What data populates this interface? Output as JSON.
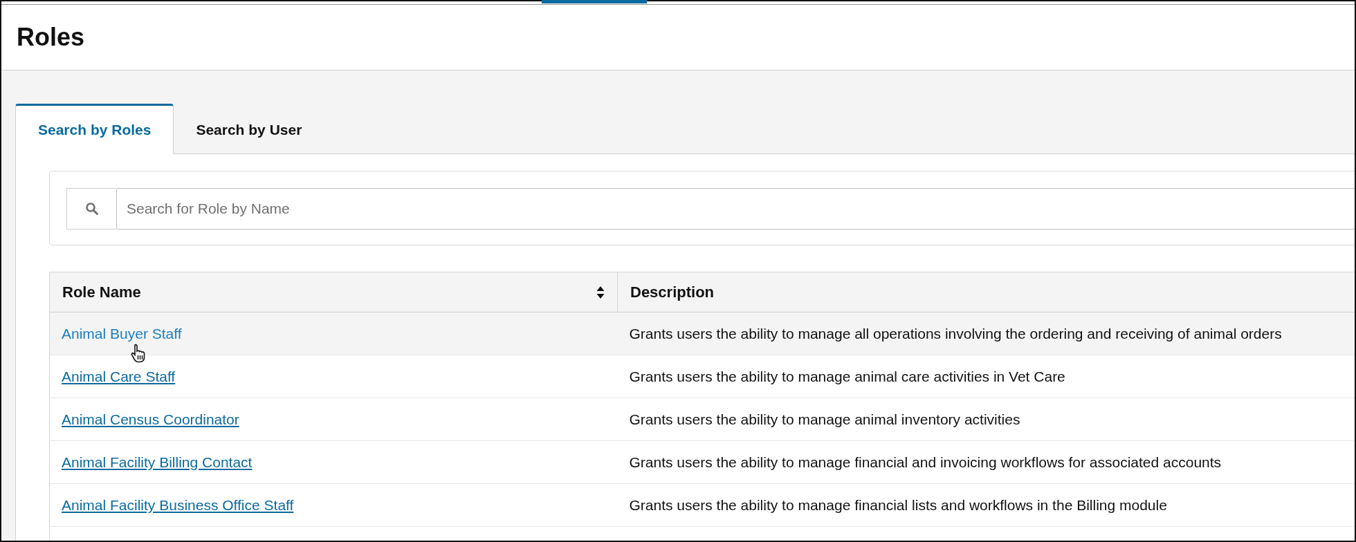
{
  "page": {
    "title": "Roles"
  },
  "tabs": [
    {
      "label": "Search by Roles",
      "selected": true
    },
    {
      "label": "Search by User",
      "selected": false
    }
  ],
  "search": {
    "placeholder": "Search for Role by Name"
  },
  "table": {
    "columns": [
      {
        "label": "Role Name",
        "sortable": true
      },
      {
        "label": "Description",
        "sortable": false
      }
    ],
    "rows": [
      {
        "role_name": "Animal Buyer Staff",
        "description": "Grants users the ability to manage all operations involving the ordering and receiving of animal orders",
        "hovered": true
      },
      {
        "role_name": "Animal Care Staff",
        "description": "Grants users the ability to manage animal care activities in Vet Care",
        "hovered": false
      },
      {
        "role_name": "Animal Census Coordinator",
        "description": "Grants users the ability to manage animal inventory activities",
        "hovered": false
      },
      {
        "role_name": "Animal Facility Billing Contact",
        "description": "Grants users the ability to manage financial and invoicing workflows for associated accounts",
        "hovered": false
      },
      {
        "role_name": "Animal Facility Business Office Staff",
        "description": "Grants users the ability to manage financial lists and workflows in the Billing module",
        "hovered": false
      }
    ]
  }
}
